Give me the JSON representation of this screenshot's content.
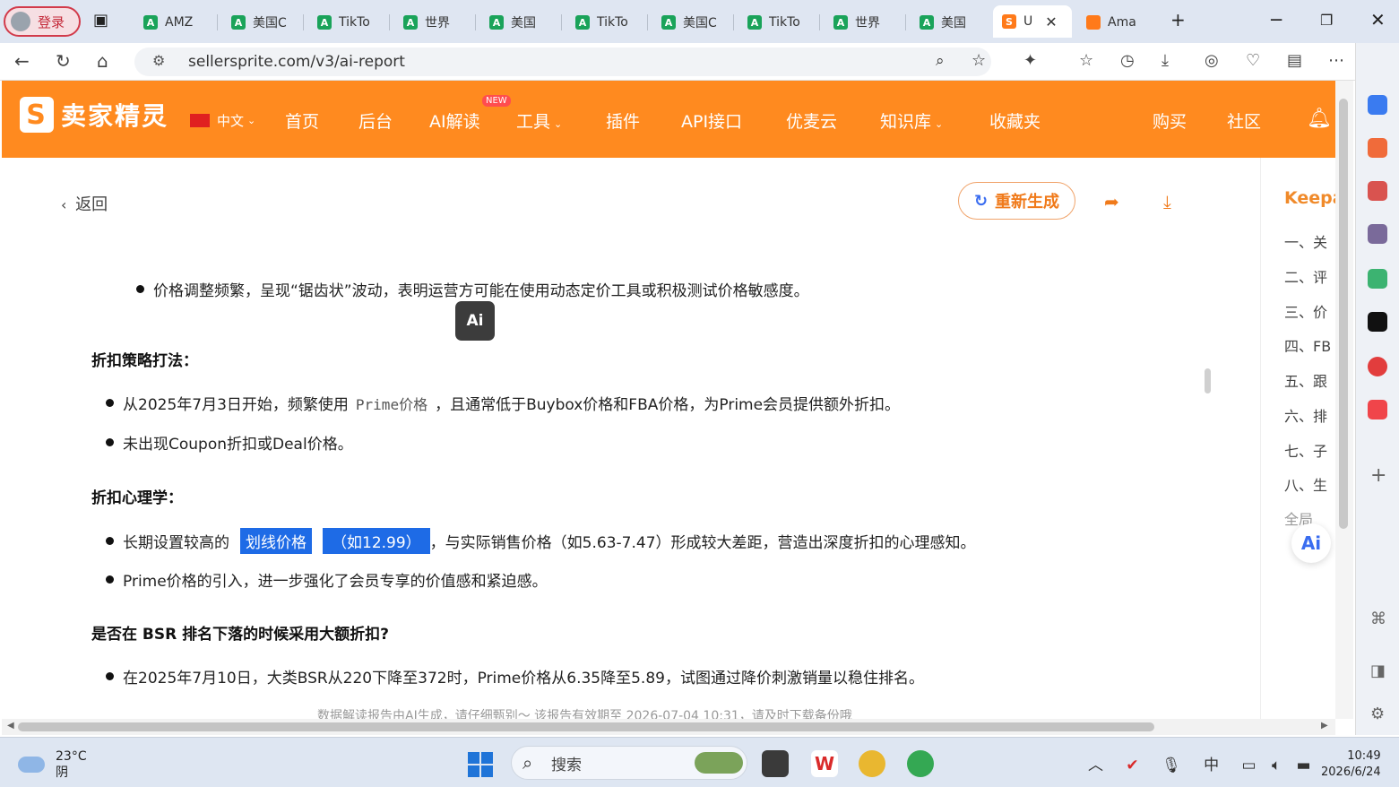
{
  "browser": {
    "login_label": "登录",
    "tabs": [
      {
        "label": "AMZ",
        "favicon": "A",
        "color": "#1aa35a"
      },
      {
        "label": "美国C",
        "favicon": "A",
        "color": "#1aa35a"
      },
      {
        "label": "TikTo",
        "favicon": "A",
        "color": "#1aa35a"
      },
      {
        "label": "世界",
        "favicon": "A",
        "color": "#1aa35a"
      },
      {
        "label": "美国",
        "favicon": "A",
        "color": "#1aa35a"
      },
      {
        "label": "TikTo",
        "favicon": "A",
        "color": "#1aa35a"
      },
      {
        "label": "美国C",
        "favicon": "A",
        "color": "#1aa35a"
      },
      {
        "label": "TikTo",
        "favicon": "A",
        "color": "#1aa35a"
      },
      {
        "label": "世界",
        "favicon": "A",
        "color": "#1aa35a"
      },
      {
        "label": "美国",
        "favicon": "A",
        "color": "#1aa35a"
      }
    ],
    "active_tab": {
      "label": "U",
      "favicon": "S"
    },
    "last_tab": {
      "label": "Ama",
      "favicon": ""
    },
    "new_tab": "+",
    "url": "sellersprite.com/v3/ai-report"
  },
  "site_nav": {
    "logo_text": "卖家精灵",
    "logo_mark": "S",
    "language": "中文",
    "items": [
      "首页",
      "后台",
      "AI解读",
      "工具",
      "插件",
      "API接口",
      "优麦云",
      "知识库",
      "收藏夹"
    ],
    "new_badge": "NEW",
    "right_items": [
      "购买",
      "社区"
    ]
  },
  "report": {
    "back_label": "返回",
    "regenerate_label": "重新生成",
    "ai_bubble": "Ai",
    "sections": {
      "bullet_top": "价格调整频繁，呈现“锯齿状”波动，表明运营方可能在使用动态定价工具或积极测试价格敏感度。",
      "discount_strategy": {
        "title": "折扣策略打法",
        "item1_pre": "从2025年7月3日开始，频繁使用",
        "item1_code": "Prime价格",
        "item1_post": "，且通常低于Buybox价格和FBA价格，为Prime会员提供额外折扣。",
        "item2": "未出现Coupon折扣或Deal价格。"
      },
      "discount_psychology": {
        "title": "折扣心理学",
        "item1_pre": "长期设置较高的",
        "item1_hl1": "划线价格",
        "item1_hl2": "（如12.99）",
        "item1_post": "，与实际销售价格（如5.63-7.47）形成较大差距，营造出深度折扣的心理感知。",
        "item2": "Prime价格的引入，进一步强化了会员专享的价值感和紧迫感。"
      },
      "bsr_question": {
        "title": "是否在 BSR 排名下落的时候采用大额折扣?",
        "item1": "在2025年7月10日，大类BSR从220下降至372时，Prime价格从6.35降至5.89，试图通过降价刺激销量以稳住排名。"
      }
    },
    "footnote": "数据解读报告由AI生成，请仔细甄别～ 该报告有效期至 2026-07-04 10:31，请及时下载备份哦"
  },
  "toc": {
    "title": "Keepa",
    "items": [
      "一、关",
      "二、评",
      "三、价",
      "四、FB",
      "五、跟",
      "六、排",
      "七、子",
      "八、生",
      "全局"
    ],
    "ai_button": "Ai"
  },
  "taskbar": {
    "temperature": "23°C",
    "weather": "阴",
    "search_placeholder": "搜索",
    "ime": "中",
    "time": "10:49",
    "date": "2026/6/24"
  },
  "colors": {
    "brand_orange": "#ff8a1f",
    "highlight_blue": "#1e6be6",
    "tab_green": "#1aa35a"
  }
}
